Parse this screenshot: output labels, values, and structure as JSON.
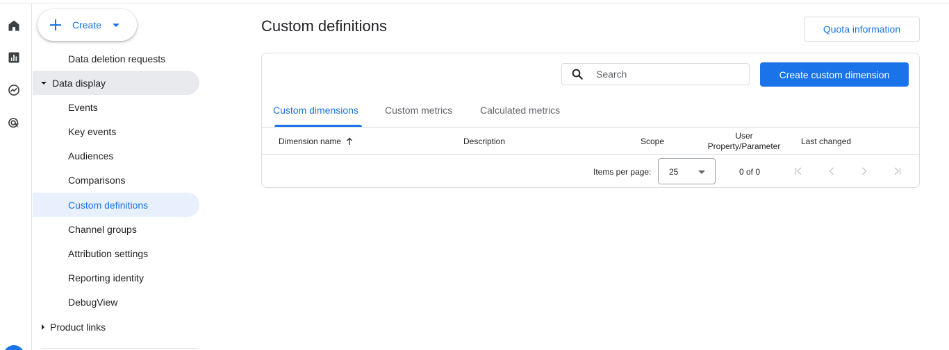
{
  "sidebar": {
    "create_label": "Create",
    "items": [
      {
        "label": "Data deletion requests"
      },
      {
        "label": "Data display"
      },
      {
        "label": "Events"
      },
      {
        "label": "Key events"
      },
      {
        "label": "Audiences"
      },
      {
        "label": "Comparisons"
      },
      {
        "label": "Custom definitions"
      },
      {
        "label": "Channel groups"
      },
      {
        "label": "Attribution settings"
      },
      {
        "label": "Reporting identity"
      },
      {
        "label": "DebugView"
      },
      {
        "label": "Product links"
      }
    ]
  },
  "rail": {
    "icons": [
      "home-icon",
      "reports-icon",
      "explore-icon",
      "advertising-icon"
    ]
  },
  "main": {
    "title": "Custom definitions",
    "quota_label": "Quota information",
    "search": {
      "placeholder": "Search",
      "value": ""
    },
    "create_button": "Create custom dimension",
    "tabs": [
      {
        "label": "Custom dimensions",
        "active": true
      },
      {
        "label": "Custom metrics"
      },
      {
        "label": "Calculated metrics"
      }
    ],
    "columns": {
      "dimension_name": "Dimension name",
      "description": "Description",
      "scope": "Scope",
      "user_property_1": "User",
      "user_property_2": "Property/Parameter",
      "last_changed": "Last changed"
    },
    "pager": {
      "items_per_page_label": "Items per page:",
      "items_per_page_value": "25",
      "range": "0 of 0"
    }
  },
  "colors": {
    "accent": "#1a73e8",
    "active_nav_bg": "#e8f0fe",
    "expanded_group_bg": "#e8eaed"
  }
}
